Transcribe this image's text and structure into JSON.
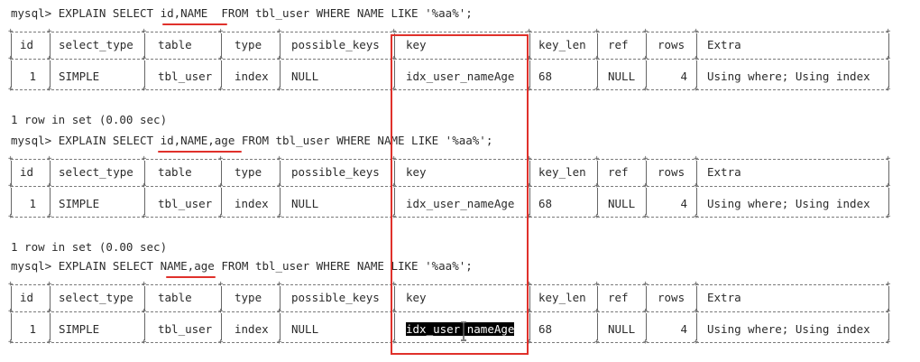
{
  "queries": [
    {
      "prompt": "mysql> ",
      "sql_before": "EXPLAIN SELECT ",
      "sql_highlight": "id,NAME ",
      "sql_after": " FROM tbl_user WHERE NAME LIKE '%aa%';",
      "columns": [
        "id",
        "select_type",
        "table",
        "type",
        "possible_keys",
        "key",
        "key_len",
        "ref",
        "rows",
        "Extra"
      ],
      "row": [
        "1",
        "SIMPLE",
        "tbl_user",
        "index",
        "NULL",
        "idx_user_nameAge",
        "68",
        "NULL",
        "4",
        "Using where; Using index"
      ],
      "footer": "1 row in set (0.00 sec)"
    },
    {
      "prompt": "mysql> ",
      "sql_before": "EXPLAIN SELECT ",
      "sql_highlight": "id,NAME,age",
      "sql_after": " FROM tbl_user WHERE NAME LIKE '%aa%';",
      "columns": [
        "id",
        "select_type",
        "table",
        "type",
        "possible_keys",
        "key",
        "key_len",
        "ref",
        "rows",
        "Extra"
      ],
      "row": [
        "1",
        "SIMPLE",
        "tbl_user",
        "index",
        "NULL",
        "idx_user_nameAge",
        "68",
        "NULL",
        "4",
        "Using where; Using index"
      ],
      "footer": "1 row in set (0.00 sec)"
    },
    {
      "prompt": "mysql> ",
      "sql_before": "EXPLAIN SELECT ",
      "sql_highlight": "NAME,age",
      "sql_after": " FROM tbl_user WHERE NAME LIKE '%aa%';",
      "columns": [
        "id",
        "select_type",
        "table",
        "type",
        "possible_keys",
        "key",
        "key_len",
        "ref",
        "rows",
        "Extra"
      ],
      "row": [
        "1",
        "SIMPLE",
        "tbl_user",
        "index",
        "NULL",
        "idx_user_nameAge",
        "68",
        "NULL",
        "4",
        "Using where; Using index"
      ],
      "selected_key_part1": "idx_user",
      "selected_key_part2": "nameAge"
    }
  ],
  "colors": {
    "annotation_red": "#e0312b",
    "text": "#2b2b2b",
    "selection_bg": "#000000",
    "selection_fg": "#ffffff"
  }
}
